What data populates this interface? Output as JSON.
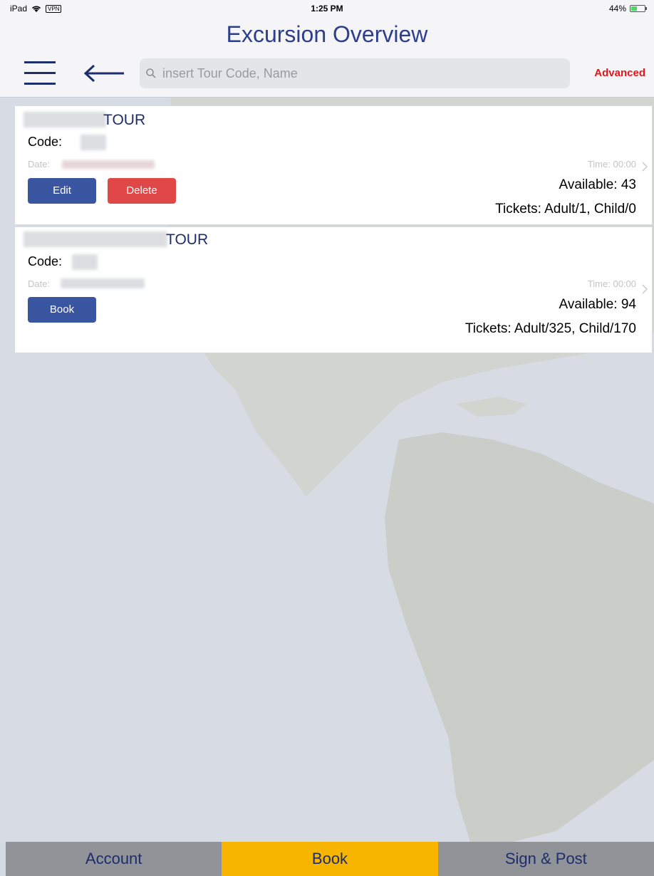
{
  "status_bar": {
    "device": "iPad",
    "vpn": "VPN",
    "time": "1:25 PM",
    "battery": "44%",
    "battery_level": 0.44
  },
  "header": {
    "title": "Excursion Overview",
    "search_placeholder": "insert Tour Code, Name",
    "advanced_label": "Advanced"
  },
  "tours": [
    {
      "title": "TOUR",
      "code_label": "Code:",
      "date_label": "Date:",
      "time_label": "Time: 00:00",
      "available": "Available: 43",
      "tickets": "Tickets: Adult/1, Child/0",
      "buttons": [
        "Edit",
        "Delete"
      ]
    },
    {
      "title": "TOUR",
      "code_label": "Code:",
      "date_label": "Date:",
      "time_label": "Time: 00:00",
      "available": "Available: 94",
      "tickets": "Tickets: Adult/325, Child/170",
      "buttons": [
        "Book"
      ]
    }
  ],
  "tab_bar": {
    "tabs": [
      "Account",
      "Book",
      "Sign & Post"
    ],
    "active": "Book"
  },
  "colors": {
    "accent": "#2c3e8c",
    "advanced": "#e8141a",
    "button_blue": "#3b56a0",
    "button_red": "#e04747",
    "active_tab": "#f7b500",
    "inactive_tab": "#909398"
  }
}
